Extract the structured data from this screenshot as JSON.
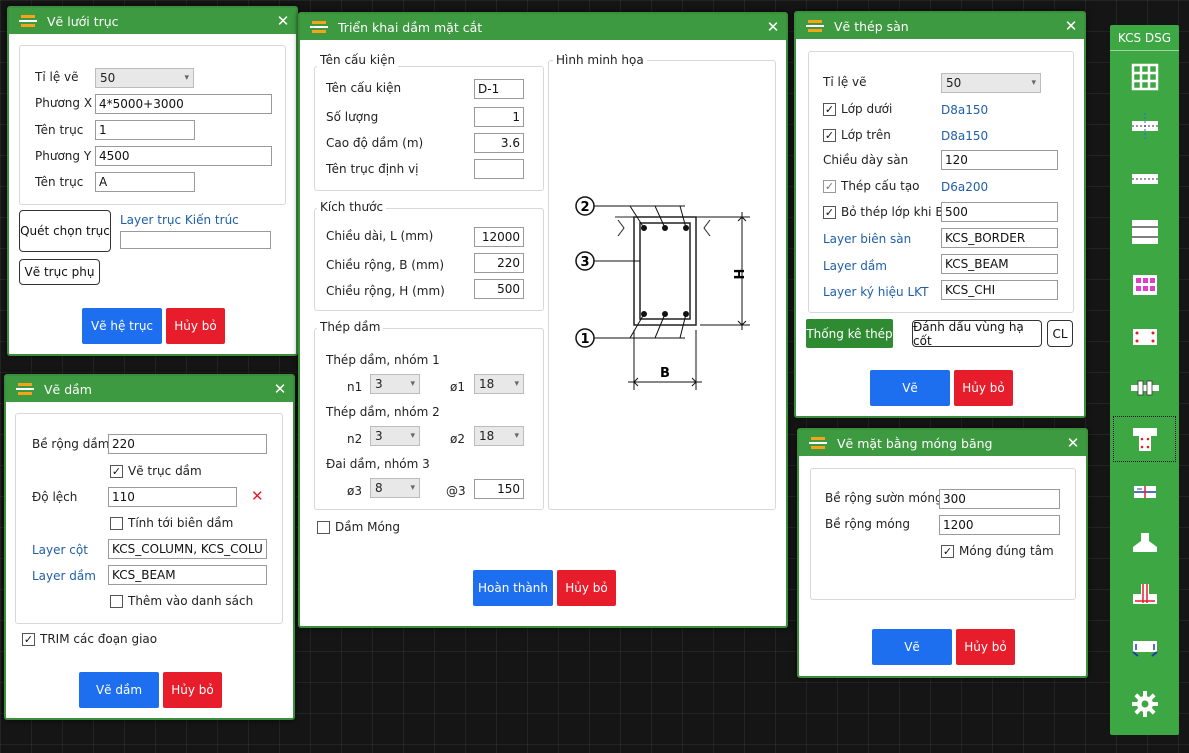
{
  "grid_dialog": {
    "title": "Vẽ lưới trục",
    "scale_label": "Tỉ lệ vẽ",
    "scale_value": "50",
    "dir_x_label": "Phương X",
    "dir_x_value": "4*5000+3000",
    "axis_name_x_label": "Tên trục",
    "axis_name_x_value": "1",
    "dir_y_label": "Phương Y",
    "dir_y_value": "4500",
    "axis_name_y_label": "Tên trục",
    "axis_name_y_value": "A",
    "pick_axis_button": "Quét chọn trục",
    "layer_label": "Layer trục Kiến trúc",
    "layer_value": "",
    "sub_axis_button": "Vẽ trục phụ",
    "ok_button": "Vẽ hệ trục",
    "cancel_button": "Hủy bỏ"
  },
  "beam_dialog": {
    "title": "Vẽ dầm",
    "width_label": "Bề rộng dầm",
    "width_value": "220",
    "draw_axis_label": "Vẽ trục dầm",
    "offset_label": "Độ lệch",
    "offset_value": "110",
    "edge_label": "Tính tới biên dầm",
    "column_layer_label": "Layer cột",
    "column_layer_value": "KCS_COLUMN, KCS_COLUMN",
    "beam_layer_label": "Layer dầm",
    "beam_layer_value": "KCS_BEAM",
    "add_list_label": "Thêm vào danh sách",
    "trim_label": "TRIM các đoạn giao",
    "ok_button": "Vẽ dầm",
    "cancel_button": "Hủy bỏ"
  },
  "section_dialog": {
    "title": "Triển khai dầm mặt cắt",
    "group_name_title": "Tên cấu kiện",
    "name_label": "Tên cấu kiện",
    "name_value": "D-1",
    "qty_label": "Số lượng",
    "qty_value": "1",
    "elev_label": "Cao độ dầm (m)",
    "elev_value": "3.6",
    "axis_label": "Tên trục định vị",
    "axis_value": "",
    "group_size_title": "Kích thước",
    "length_label": "Chiều dài, L (mm)",
    "length_value": "12000",
    "width_label": "Chiều rộng, B (mm)",
    "width_value": "220",
    "height_label": "Chiều rộng, H (mm)",
    "height_value": "500",
    "group_steel_title": "Thép dầm",
    "g1_label": "Thép dầm, nhóm 1",
    "n1_label": "n1",
    "n1_value": "3",
    "d1_label": "ø1",
    "d1_value": "18",
    "g2_label": "Thép dầm, nhóm 2",
    "n2_label": "n2",
    "n2_value": "3",
    "d2_label": "ø2",
    "d2_value": "18",
    "g3_label": "Đai dầm, nhóm 3",
    "d3_label": "ø3",
    "d3_value": "8",
    "s3_label": "@3",
    "s3_value": "150",
    "foundation_label": "Dầm Móng",
    "illus_title": "Hình minh họa",
    "illus_marks": [
      "1",
      "2",
      "3"
    ],
    "illus_h": "H",
    "illus_b": "B",
    "ok_button": "Hoàn thành",
    "cancel_button": "Hủy bỏ"
  },
  "slab_dialog": {
    "title": "Vẽ thép sàn",
    "scale_label": "Tỉ lệ vẽ",
    "scale_value": "50",
    "bottom_label": "Lớp dưới",
    "bottom_value": "D8a150",
    "top_label": "Lớp trên",
    "top_value": "D8a150",
    "thick_label": "Chiều dày sàn",
    "thick_value": "120",
    "construct_label": "Thép cấu tạo",
    "construct_value": "D6a200",
    "skip_label": "Bỏ thép lớp khi B",
    "skip_value": "500",
    "border_layer_label": "Layer biên sàn",
    "border_layer_value": "KCS_BORDER",
    "beam_layer_label": "Layer dầm",
    "beam_layer_value": "KCS_BEAM",
    "sym_layer_label": "Layer ký hiệu LKT",
    "sym_layer_value": "KCS_CHI",
    "stats_button": "Thống kê thép",
    "mark_button": "Đánh dấu vùng hạ cốt",
    "cl_button": "CL",
    "ok_button": "Vẽ",
    "cancel_button": "Hủy bỏ"
  },
  "strip_dialog": {
    "title": "Vẽ mặt bằng móng băng",
    "rib_label": "Bề rộng sườn móng",
    "rib_value": "300",
    "width_label": "Bề rộng móng",
    "width_value": "1200",
    "center_label": "Móng đúng tâm",
    "ok_button": "Vẽ",
    "cancel_button": "Hủy bỏ"
  },
  "sidebar": {
    "title": "KCS DSG",
    "tools": [
      "grid-tool-icon",
      "section-axis-icon",
      "beam-line-icon",
      "slab-layer-icon",
      "pink-grid-icon",
      "beam-section-icon",
      "beam-rebar-icon",
      "column-section-icon",
      "footing-plan-icon",
      "footing-icon",
      "pile-footing-icon",
      "foundation-beam-icon",
      "settings-icon"
    ]
  },
  "colors": {
    "title_green": "#3e9a40",
    "button_blue": "#1e6ff0",
    "button_red": "#e81d2b",
    "label_blue": "#1f5fa8"
  }
}
